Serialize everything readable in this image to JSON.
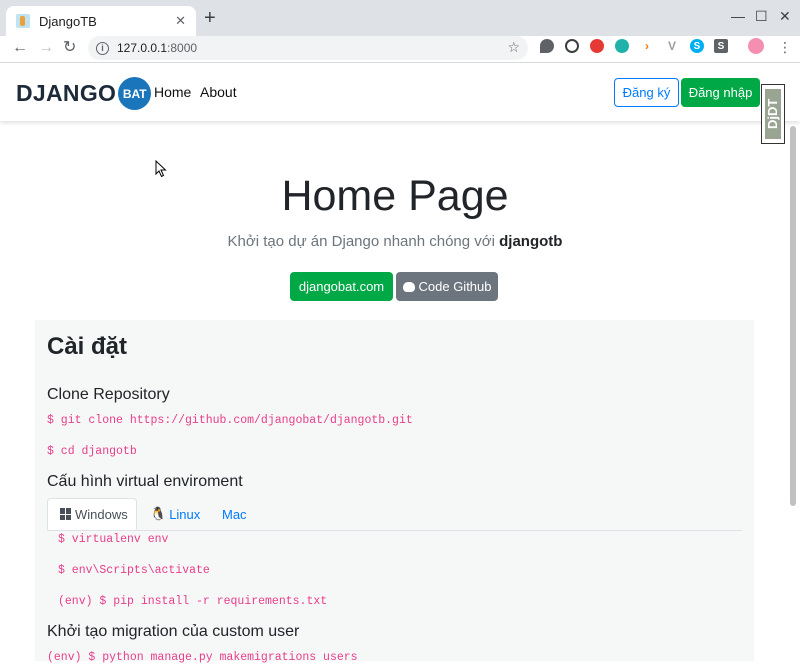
{
  "browser": {
    "tab_title": "DjangoTB",
    "tab_close": "✕",
    "new_tab": "+",
    "url_host": "127.0.0.1",
    "url_port": ":8000",
    "win_min": "—",
    "win_max": "☐",
    "win_close": "✕"
  },
  "navbar": {
    "brand_text": "DJANGO",
    "brand_badge": "BAT",
    "links": [
      "Home",
      "About"
    ],
    "register_label": "Đăng ký",
    "login_label": "Đăng nhập",
    "debug_toolbar_label": "DjDT"
  },
  "hero": {
    "title": "Home Page",
    "subtitle_prefix": "Khởi tạo dự án Django nhanh chóng với ",
    "subtitle_bold": "djangotb",
    "site_button": "djangobat.com",
    "github_button": "Code Github"
  },
  "install": {
    "heading": "Cài đặt",
    "clone_heading": "Clone Repository",
    "clone_cmd": "$ git clone https://github.com/djangobat/djangotb.git",
    "cd_cmd": "$ cd djangotb",
    "venv_heading": "Cấu hình virtual enviroment",
    "tabs": [
      "Windows",
      "Linux",
      "Mac"
    ],
    "windows_cmds": [
      "$ virtualenv env",
      "$ env\\Scripts\\activate",
      "(env) $ pip install -r requirements.txt"
    ],
    "migration_heading": "Khởi tạo migration của custom user",
    "migration_cmd": "(env) $ python manage.py makemigrations users"
  },
  "colors": {
    "green": "#00a846",
    "blue": "#007bff",
    "gray": "#6c757d",
    "code_pink": "#e83e8c",
    "brand_blue": "#1b75bb"
  }
}
